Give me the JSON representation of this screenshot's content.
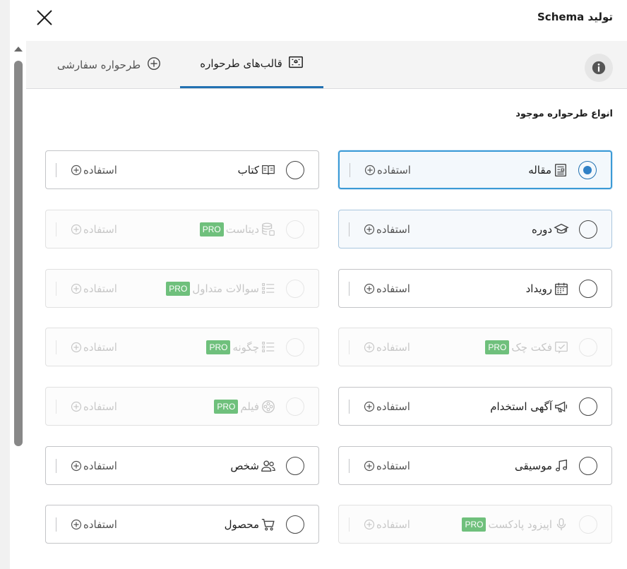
{
  "modal": {
    "title": "تولید Schema"
  },
  "tabs": [
    {
      "label": "قالب‌های طرحواره",
      "icon": "template-icon"
    },
    {
      "label": "طرحواره سفارشی",
      "icon": "plus-circle-icon"
    }
  ],
  "section": {
    "title": "انواع طرحواره موجود"
  },
  "pro_label": "PRO",
  "use_label": "استفاده",
  "cards": [
    {
      "label": "مقاله",
      "icon": "article-icon",
      "state": "selected",
      "pro": false
    },
    {
      "label": "کتاب",
      "icon": "book-icon",
      "state": "normal",
      "pro": false
    },
    {
      "label": "دوره",
      "icon": "graduation-cap-icon",
      "state": "hover",
      "pro": false
    },
    {
      "label": "دیتاست",
      "icon": "database-icon",
      "state": "disabled",
      "pro": true
    },
    {
      "label": "رویداد",
      "icon": "calendar-icon",
      "state": "normal",
      "pro": false
    },
    {
      "label": "سوالات متداول",
      "icon": "list-icon",
      "state": "disabled",
      "pro": true
    },
    {
      "label": "فکت چک",
      "icon": "fact-check-icon",
      "state": "disabled",
      "pro": true
    },
    {
      "label": "چگونه",
      "icon": "list-icon",
      "state": "disabled",
      "pro": true
    },
    {
      "label": "آگهی استخدام",
      "icon": "megaphone-icon",
      "state": "normal",
      "pro": false
    },
    {
      "label": "فیلم",
      "icon": "film-reel-icon",
      "state": "disabled",
      "pro": true
    },
    {
      "label": "موسیقی",
      "icon": "music-note-icon",
      "state": "normal",
      "pro": false
    },
    {
      "label": "شخص",
      "icon": "people-icon",
      "state": "normal",
      "pro": false
    },
    {
      "label": "اپیزود پادکست",
      "icon": "microphone-icon",
      "state": "disabled",
      "pro": true
    },
    {
      "label": "محصول",
      "icon": "cart-icon",
      "state": "normal",
      "pro": false
    }
  ]
}
